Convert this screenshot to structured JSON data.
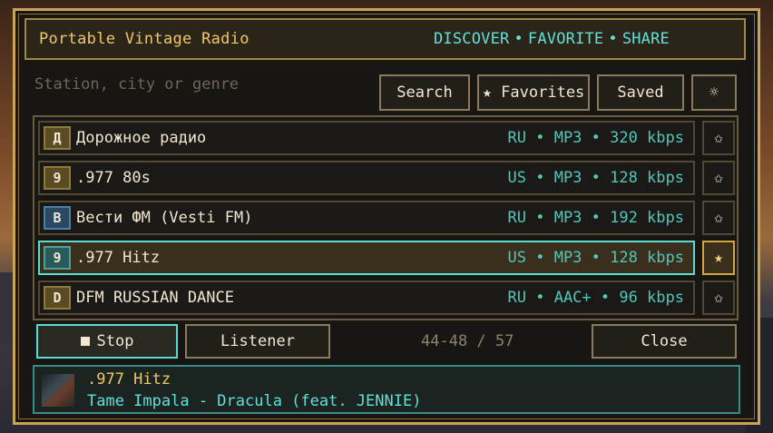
{
  "window": {
    "title": "Portable Vintage Radio",
    "links": [
      "DISCOVER",
      "FAVORITE",
      "SHARE"
    ],
    "link_separator": "•"
  },
  "search": {
    "placeholder": "Station, city or genre",
    "value": ""
  },
  "toolbar": {
    "search_label": "Search",
    "favorites_label": "★ Favorites",
    "saved_label": "Saved",
    "settings_icon": "☼"
  },
  "stations": [
    {
      "badge": "Д",
      "name": "Дорожное радио",
      "meta": "RU • MP3 • 320 kbps",
      "favorite": false,
      "selected": false
    },
    {
      "badge": "9",
      "name": ".977 80s",
      "meta": "US • MP3 • 128 kbps",
      "favorite": false,
      "selected": false
    },
    {
      "badge": "В",
      "name": "Вести ФМ (Vesti FM)",
      "meta": "RU • MP3 • 192 kbps",
      "favorite": false,
      "selected": false
    },
    {
      "badge": "9",
      "name": ".977 Hitz",
      "meta": "US • MP3 • 128 kbps",
      "favorite": true,
      "selected": true
    },
    {
      "badge": "D",
      "name": "DFM RUSSIAN DANCE",
      "meta": "RU • AAC+ • 96 kbps",
      "favorite": false,
      "selected": false
    }
  ],
  "star_empty": "✩",
  "star_filled": "★",
  "controls": {
    "stop_label": "Stop",
    "listener_label": "Listener",
    "pager": "44-48 / 57",
    "close_label": "Close"
  },
  "now_playing": {
    "station": ".977 Hitz",
    "track": "Tame Impala - Dracula (feat. JENNIE)"
  },
  "colors": {
    "accent_gold": "#c9a356",
    "accent_cyan": "#58dcd2",
    "title_yellow": "#f0c868"
  }
}
